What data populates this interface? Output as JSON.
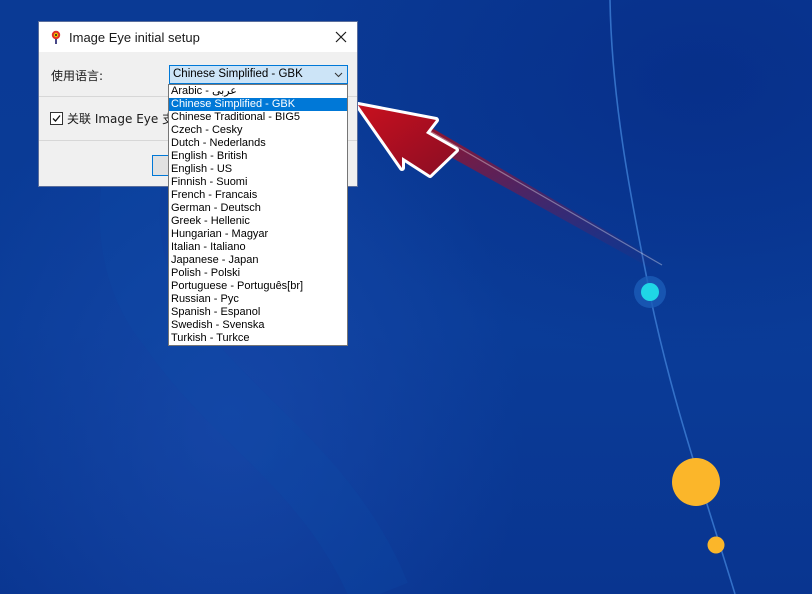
{
  "window": {
    "title": "Image Eye initial setup",
    "language_label": "使用语言:",
    "selected_language": "Chinese Simplified - GBK",
    "associate_label": "关联 Image Eye 支持",
    "associate_checked": true,
    "ok_label": ""
  },
  "dropdown": {
    "selected_index": 1,
    "options": [
      "Arabic - عربى",
      "Chinese Simplified - GBK",
      "Chinese Traditional - BIG5",
      "Czech - Cesky",
      "Dutch - Nederlands",
      "English - British",
      "English - US",
      "Finnish - Suomi",
      "French - Francais",
      "German - Deutsch",
      "Greek - Hellenic",
      "Hungarian - Magyar",
      "Italian - Italiano",
      "Japanese - Japan",
      "Polish - Polski",
      "Portuguese - Português[br]",
      "Russian - Pyc",
      "Spanish - Espanol",
      "Swedish - Svenska",
      "Turkish - Turkce"
    ]
  },
  "colors": {
    "accent": "#0078d7",
    "arrow": "#b0101c",
    "cyan_dot": "#1fd6e6",
    "yellow_dot": "#fbb62a"
  },
  "icons": {
    "app": "image-eye-app-icon",
    "close": "close-icon",
    "dropdown": "chevron-down-icon"
  }
}
